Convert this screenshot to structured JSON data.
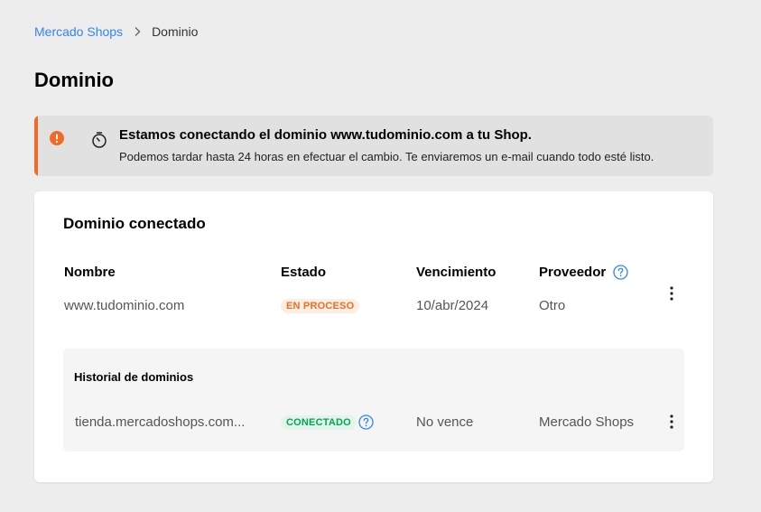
{
  "breadcrumb": {
    "parent": "Mercado Shops",
    "current": "Dominio"
  },
  "page": {
    "title": "Dominio"
  },
  "notice": {
    "title": "Estamos conectando el dominio www.tudominio.com a tu Shop.",
    "text": "Podemos tardar hasta 24 horas en efectuar el cambio. Te enviaremos un e-mail cuando todo esté listo.",
    "accent_color": "#f16b26"
  },
  "connected": {
    "title": "Dominio conectado",
    "columns": {
      "name": "Nombre",
      "status": "Estado",
      "expiry": "Vencimiento",
      "provider": "Proveedor"
    },
    "row": {
      "name": "www.tudominio.com",
      "status": "EN PROCESO",
      "expiry": "10/abr/2024",
      "provider": "Otro"
    }
  },
  "history": {
    "title": "Historial de dominios",
    "row": {
      "name": "tienda.mercadoshops.com...",
      "status": "CONECTADO",
      "expiry": "No vence",
      "provider": "Mercado Shops"
    }
  },
  "colors": {
    "link": "#3483fa",
    "warning": "#f16b26",
    "success": "#00a650"
  }
}
